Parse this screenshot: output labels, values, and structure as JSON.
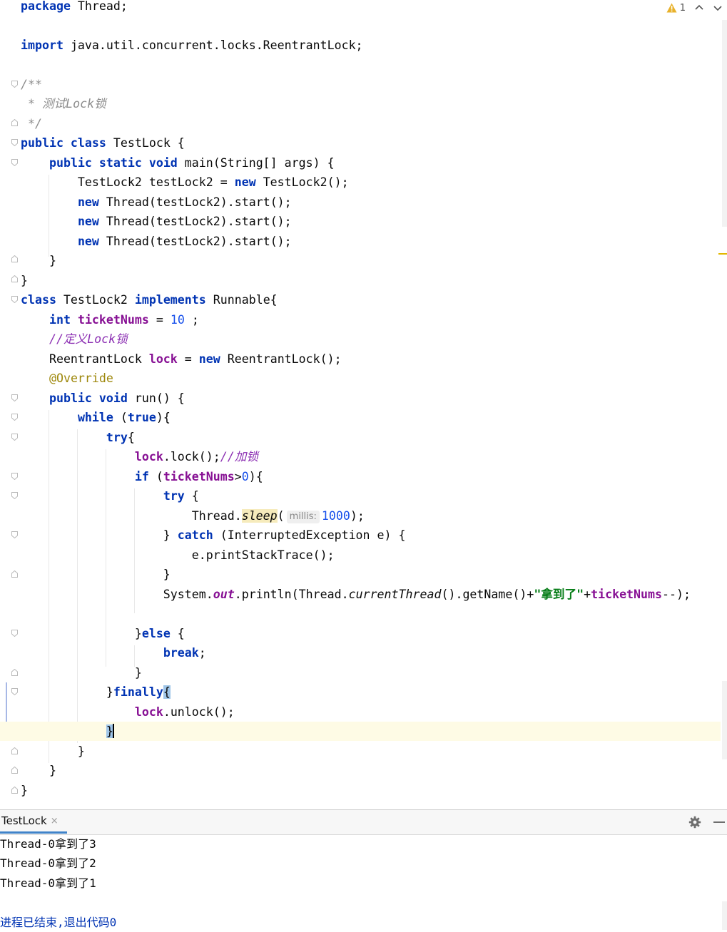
{
  "inspection": {
    "warning_count": "1"
  },
  "code": {
    "l1": [
      "package",
      " Thread;"
    ],
    "l3": [
      "import",
      " java.util.concurrent.locks.ReentrantLock;"
    ],
    "l5": "/**",
    "l6": " * 测试Lock锁",
    "l7": " */",
    "l8": [
      "public class",
      " TestLock {"
    ],
    "l9": [
      "    ",
      "public static void",
      " main(String[] args) {"
    ],
    "l10": [
      "        TestLock2 testLock2 = ",
      "new",
      " TestLock2();"
    ],
    "l11": [
      "        ",
      "new",
      " Thread(testLock2).start();"
    ],
    "l12": [
      "        ",
      "new",
      " Thread(testLock2).start();"
    ],
    "l13": [
      "        ",
      "new",
      " Thread(testLock2).start();"
    ],
    "l14": "    }",
    "l15": "}",
    "l16": [
      "class",
      " TestLock2 ",
      "implements",
      " Runnable{"
    ],
    "l17": [
      "    ",
      "int",
      " ",
      "ticketNums",
      " = ",
      "10",
      " ;"
    ],
    "l18": [
      "    ",
      "//定义Lock锁"
    ],
    "l19": [
      "    ReentrantLock ",
      "lock",
      " = ",
      "new",
      " ReentrantLock();"
    ],
    "l20": [
      "    ",
      "@Override"
    ],
    "l21": [
      "    ",
      "public void",
      " run() {"
    ],
    "l22": [
      "        ",
      "while",
      " (",
      "true",
      "){"
    ],
    "l23": [
      "            ",
      "try",
      "{"
    ],
    "l24": [
      "                ",
      "lock",
      ".lock();",
      "//加锁"
    ],
    "l25": [
      "                ",
      "if",
      " (",
      "ticketNums",
      ">",
      "0",
      "){"
    ],
    "l26": [
      "                    ",
      "try",
      " {"
    ],
    "l27": [
      "                        Thread.",
      "sleep",
      "(",
      "millis:",
      "1000",
      ");"
    ],
    "l28": [
      "                    } ",
      "catch",
      " (InterruptedException e) {"
    ],
    "l29": "                        e.printStackTrace();",
    "l30": "                    }",
    "l31": [
      "                    System.",
      "out",
      ".println(Thread.",
      "currentThread",
      "().getName()+",
      "\"拿到了\"",
      "+",
      "ticketNums",
      "--);"
    ],
    "l33": [
      "                }",
      "else",
      " {"
    ],
    "l34": [
      "                    ",
      "break",
      ";"
    ],
    "l35": "                }",
    "l36": [
      "            }",
      "finally",
      "{"
    ],
    "l37": [
      "                ",
      "lock",
      ".unlock();"
    ],
    "l38": [
      "            ",
      "}"
    ],
    "l39": "        }",
    "l40": "    }",
    "l41": "}"
  },
  "run_panel": {
    "tab_label": "TestLock",
    "close_glyph": "×",
    "output": [
      "Thread-0拿到了3",
      "Thread-0拿到了2",
      "Thread-0拿到了1"
    ],
    "exit_message": "进程已结束,退出代码0"
  },
  "icons": {
    "warning": "warning-triangle-icon",
    "prev": "chevron-up-icon",
    "next": "chevron-down-icon",
    "settings": "gear-icon",
    "minimize": "minimize-icon",
    "close": "close-icon"
  },
  "colors": {
    "keyword": "#0033b3",
    "field": "#871094",
    "number": "#1750eb",
    "string": "#067d17",
    "comment": "#8c8c8c",
    "annotation": "#9e880d",
    "current_line": "#fefbe5",
    "tab_underline": "#4083c9"
  }
}
